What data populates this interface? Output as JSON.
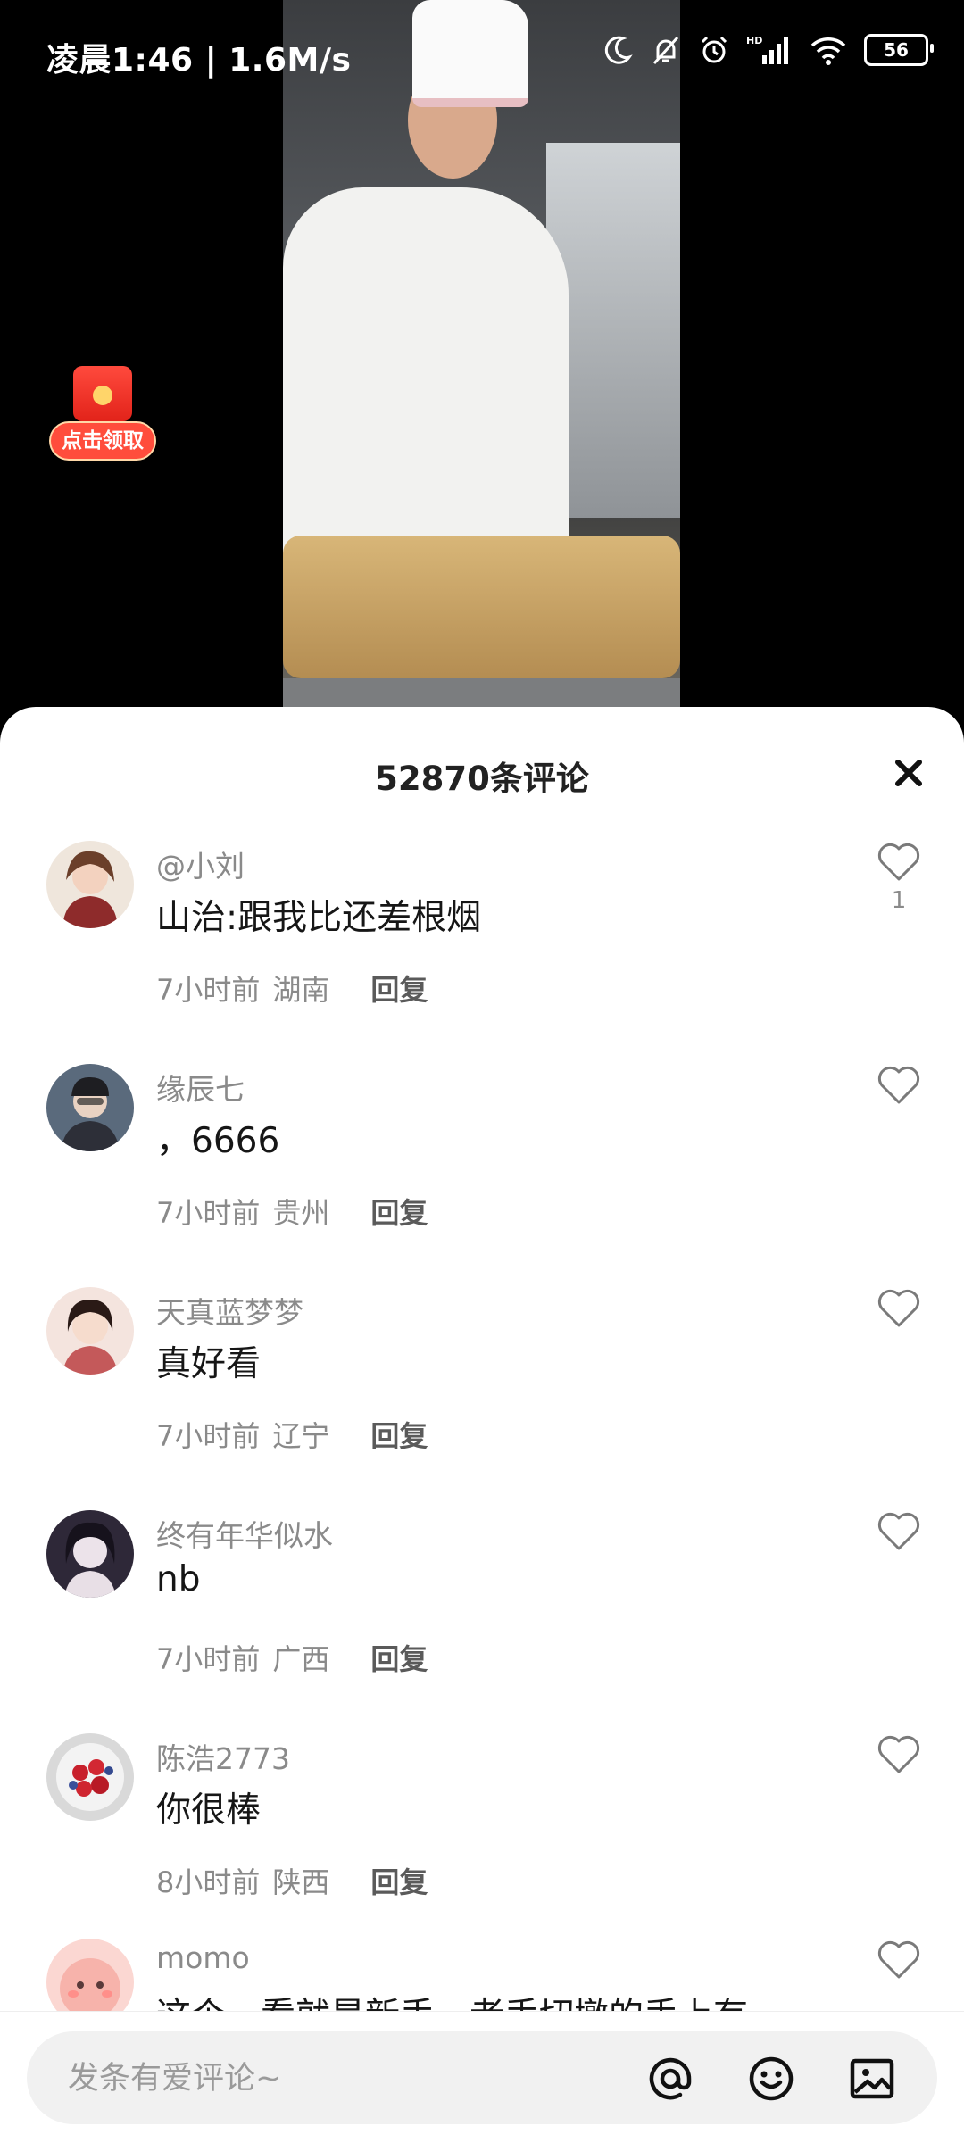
{
  "status_bar": {
    "time_speed": "凌晨1:46 | 1.6M/s",
    "network_badge": "HD",
    "battery": "56"
  },
  "red_packet": {
    "label": "点击领取"
  },
  "sheet": {
    "title": "52870条评论",
    "comments": [
      {
        "username": "@小刘",
        "text": "山治:跟我比还差根烟",
        "time": "7小时前",
        "region": "湖南",
        "reply": "回复",
        "likes": "1"
      },
      {
        "username": "缘辰七",
        "text": "，6666",
        "time": "7小时前",
        "region": "贵州",
        "reply": "回复",
        "likes": ""
      },
      {
        "username": "天真蓝梦梦",
        "text": "真好看",
        "time": "7小时前",
        "region": "辽宁",
        "reply": "回复",
        "likes": ""
      },
      {
        "username": "终有年华似水",
        "text": "nb",
        "time": "7小时前",
        "region": "广西",
        "reply": "回复",
        "likes": ""
      },
      {
        "username": "陈浩2773",
        "text": "你很棒",
        "time": "8小时前",
        "region": "陕西",
        "reply": "回复",
        "likes": ""
      },
      {
        "username": "momo",
        "text": "这个一看就是新手，老手切墩的手上有",
        "time": "",
        "region": "",
        "reply": "",
        "likes": ""
      }
    ]
  },
  "input_bar": {
    "placeholder": "发条有爱评论~"
  },
  "colors": {
    "accent_red": "#ff4d3c",
    "meta_gray": "#8a8a8a",
    "sheet_bg": "#ffffff"
  }
}
